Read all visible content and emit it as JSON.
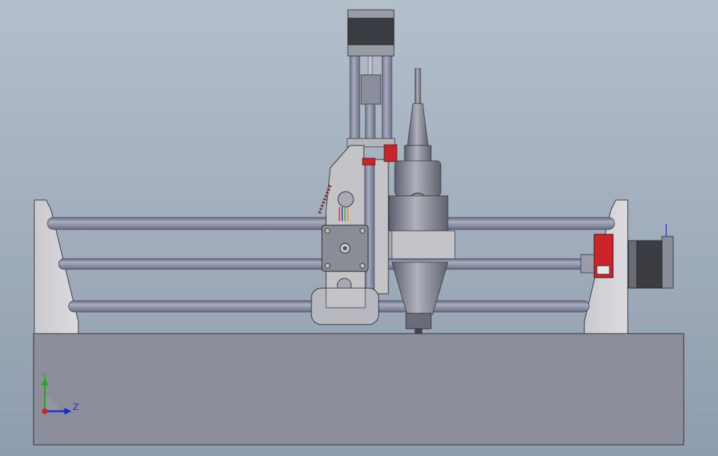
{
  "viewport": {
    "background_top": "#b3bfcb",
    "background_bottom": "#8f9cad"
  },
  "colors": {
    "frame_plate": "#d2d2d6",
    "base_plate": "#8c8e9b",
    "rod": "#8d92a8",
    "carriage": "#c3c3c8",
    "spindle": "#9a9aa6",
    "motor_dark": "#3a3c42",
    "driver_board": "#c8242a",
    "x_axis_color": "#d22222",
    "y_axis_color": "#22aa22",
    "z_axis_color": "#1a2ad4"
  },
  "triad": {
    "y_label": "Y",
    "z_label": "Z"
  },
  "icons": [
    "stepper-motor-icon",
    "spindle-icon",
    "driver-board-icon",
    "coordinate-triad-icon"
  ]
}
